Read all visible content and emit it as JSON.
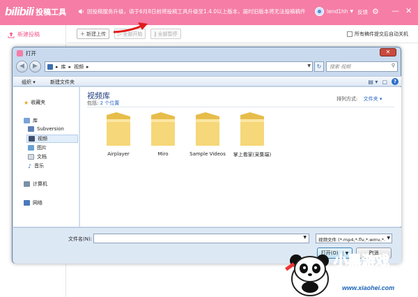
{
  "app": {
    "logo_text": "bilibili",
    "logo_subtitle": "投稿工具",
    "notice": "因投稿服务升级，请于6月8日前将投稿工具升级至1.4.0以上版本，届时旧版本将无法投稿稿件",
    "username": "lend1hh",
    "feedback": "反馈",
    "new_post": "新建投稿",
    "brand_color": "#f57da6"
  },
  "toolbar": {
    "new_upload": "新建上传",
    "start_all": "全部开始",
    "pause_all": "全部暂停",
    "auto_shutdown": "所有稿件提交后自动关机"
  },
  "dialog": {
    "title": "打开",
    "breadcrumb": [
      "库",
      "视频"
    ],
    "search_placeholder": "搜索 视频",
    "commands": {
      "organize": "组织",
      "new_folder": "新建文件夹"
    },
    "nav": {
      "favorites": "收藏夹",
      "libraries": "库",
      "library_items": [
        "Subversion",
        "视频",
        "图片",
        "文档",
        "音乐"
      ],
      "computer": "计算机",
      "network": "网络"
    },
    "library_title": "视频库",
    "includes_label": "包括:",
    "includes_value": "2 个位置",
    "sort_label": "排列方式:",
    "sort_value": "文件夹",
    "folders": [
      "Airplayer",
      "Miro",
      "Sample Videos",
      "掌上看家(采集端)"
    ],
    "filename_label": "文件名(N):",
    "filename_value": "",
    "filetype_value": "视频文件 (*.mp4,*.flv,*.wmv,*.",
    "open_button": "打开(O)",
    "cancel_button": "取消"
  },
  "watermark": {
    "brand": "小黑游戏",
    "site": "www.xiaohei.com"
  }
}
